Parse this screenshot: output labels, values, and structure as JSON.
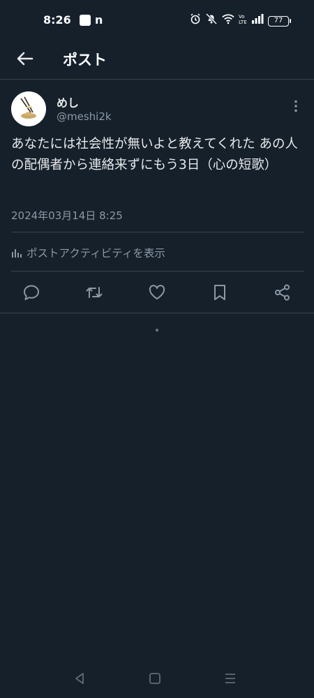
{
  "status_bar": {
    "time": "8:26",
    "battery": "77",
    "app_icon_2": "n"
  },
  "header": {
    "title": "ポスト",
    "back_icon": "arrow-left-icon"
  },
  "tweet": {
    "author_name": "めし",
    "author_handle": "@meshi2k",
    "text": "あなたには社会性が無いよと教えてくれた あの人の配偶者から連絡来ずにもう3日（心の短歌）",
    "timestamp": "2024年03月14日 8:25"
  },
  "analytics_link": {
    "label": "ポストアクティビティを表示"
  },
  "actions": {
    "icons": [
      "reply-icon",
      "retweet-icon",
      "like-icon",
      "bookmark-icon",
      "share-icon"
    ]
  },
  "colors": {
    "background": "#15202b",
    "text_primary": "#e7e9ea",
    "text_secondary": "#8b98a5",
    "divider": "#38444d"
  }
}
